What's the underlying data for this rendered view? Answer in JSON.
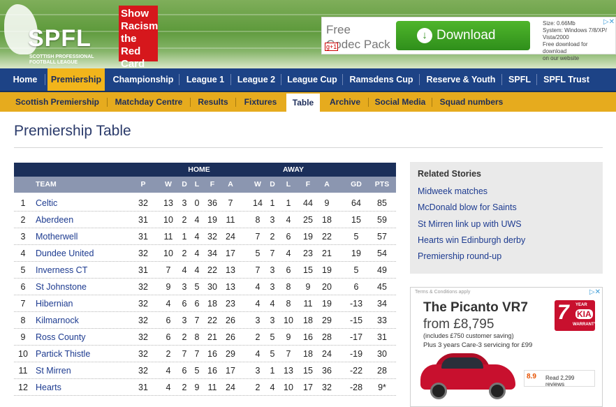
{
  "header": {
    "brand": "SPFL",
    "brand_sub": "SCOTTISH PROFESSIONAL FOOTBALL LEAGUE",
    "badge_lines": [
      "Show",
      "Racism",
      "the Red",
      "Card"
    ],
    "ad": {
      "title_line1": "Free",
      "title_line2": "Codec Pack",
      "button_label": "Download",
      "info_lines": [
        "Size: 0.66Mb",
        "System: Windows 7/8/XP/",
        "Vista/2000",
        "Free download for download",
        "on our website"
      ],
      "close": "▷✕"
    }
  },
  "nav_primary": [
    {
      "label": "Home",
      "active": false
    },
    {
      "label": "Premiership",
      "active": true
    },
    {
      "label": "Championship",
      "active": false
    },
    {
      "label": "League 1",
      "active": false
    },
    {
      "label": "League 2",
      "active": false
    },
    {
      "label": "League Cup",
      "active": false
    },
    {
      "label": "Ramsdens Cup",
      "active": false
    },
    {
      "label": "Reserve & Youth",
      "active": false
    },
    {
      "label": "SPFL",
      "active": false
    },
    {
      "label": "SPFL Trust",
      "active": false
    }
  ],
  "nav_secondary": [
    {
      "label": "Scottish Premiership",
      "active": false
    },
    {
      "label": "Matchday Centre",
      "active": false
    },
    {
      "label": "Results",
      "active": false
    },
    {
      "label": "Fixtures",
      "active": false
    },
    {
      "label": "Table",
      "active": true
    },
    {
      "label": "Archive",
      "active": false
    },
    {
      "label": "Social Media",
      "active": false
    },
    {
      "label": "Squad numbers",
      "active": false
    }
  ],
  "page_title": "Premiership Table",
  "table": {
    "group_home": "HOME",
    "group_away": "AWAY",
    "columns": [
      "TEAM",
      "P",
      "W",
      "D",
      "L",
      "F",
      "A",
      "W",
      "D",
      "L",
      "F",
      "A",
      "GD",
      "PTS"
    ],
    "rows": [
      {
        "pos": "1",
        "team": "Celtic",
        "p": "32",
        "hw": "13",
        "hd": "3",
        "hl": "0",
        "hf": "36",
        "ha": "7",
        "aw": "14",
        "ad": "1",
        "al": "1",
        "af": "44",
        "aa": "9",
        "gd": "64",
        "pts": "85"
      },
      {
        "pos": "2",
        "team": "Aberdeen",
        "p": "31",
        "hw": "10",
        "hd": "2",
        "hl": "4",
        "hf": "19",
        "ha": "11",
        "aw": "8",
        "ad": "3",
        "al": "4",
        "af": "25",
        "aa": "18",
        "gd": "15",
        "pts": "59"
      },
      {
        "pos": "3",
        "team": "Motherwell",
        "p": "31",
        "hw": "11",
        "hd": "1",
        "hl": "4",
        "hf": "32",
        "ha": "24",
        "aw": "7",
        "ad": "2",
        "al": "6",
        "af": "19",
        "aa": "22",
        "gd": "5",
        "pts": "57"
      },
      {
        "pos": "4",
        "team": "Dundee United",
        "p": "32",
        "hw": "10",
        "hd": "2",
        "hl": "4",
        "hf": "34",
        "ha": "17",
        "aw": "5",
        "ad": "7",
        "al": "4",
        "af": "23",
        "aa": "21",
        "gd": "19",
        "pts": "54"
      },
      {
        "pos": "5",
        "team": "Inverness CT",
        "p": "31",
        "hw": "7",
        "hd": "4",
        "hl": "4",
        "hf": "22",
        "ha": "13",
        "aw": "7",
        "ad": "3",
        "al": "6",
        "af": "15",
        "aa": "19",
        "gd": "5",
        "pts": "49"
      },
      {
        "pos": "6",
        "team": "St Johnstone",
        "p": "32",
        "hw": "9",
        "hd": "3",
        "hl": "5",
        "hf": "30",
        "ha": "13",
        "aw": "4",
        "ad": "3",
        "al": "8",
        "af": "9",
        "aa": "20",
        "gd": "6",
        "pts": "45"
      },
      {
        "pos": "7",
        "team": "Hibernian",
        "p": "32",
        "hw": "4",
        "hd": "6",
        "hl": "6",
        "hf": "18",
        "ha": "23",
        "aw": "4",
        "ad": "4",
        "al": "8",
        "af": "11",
        "aa": "19",
        "gd": "-13",
        "pts": "34"
      },
      {
        "pos": "8",
        "team": "Kilmarnock",
        "p": "32",
        "hw": "6",
        "hd": "3",
        "hl": "7",
        "hf": "22",
        "ha": "26",
        "aw": "3",
        "ad": "3",
        "al": "10",
        "af": "18",
        "aa": "29",
        "gd": "-15",
        "pts": "33"
      },
      {
        "pos": "9",
        "team": "Ross County",
        "p": "32",
        "hw": "6",
        "hd": "2",
        "hl": "8",
        "hf": "21",
        "ha": "26",
        "aw": "2",
        "ad": "5",
        "al": "9",
        "af": "16",
        "aa": "28",
        "gd": "-17",
        "pts": "31"
      },
      {
        "pos": "10",
        "team": "Partick Thistle",
        "p": "32",
        "hw": "2",
        "hd": "7",
        "hl": "7",
        "hf": "16",
        "ha": "29",
        "aw": "4",
        "ad": "5",
        "al": "7",
        "af": "18",
        "aa": "24",
        "gd": "-19",
        "pts": "30"
      },
      {
        "pos": "11",
        "team": "St Mirren",
        "p": "32",
        "hw": "4",
        "hd": "6",
        "hl": "5",
        "hf": "16",
        "ha": "17",
        "aw": "3",
        "ad": "1",
        "al": "13",
        "af": "15",
        "aa": "36",
        "gd": "-22",
        "pts": "28"
      },
      {
        "pos": "12",
        "team": "Hearts",
        "p": "31",
        "hw": "4",
        "hd": "2",
        "hl": "9",
        "hf": "11",
        "ha": "24",
        "aw": "2",
        "ad": "4",
        "al": "10",
        "af": "17",
        "aa": "32",
        "gd": "-28",
        "pts": "9*"
      }
    ]
  },
  "related": {
    "heading": "Related Stories",
    "stories": [
      "Midweek matches",
      "McDonald blow for Saints",
      "St Mirren link up with UWS",
      "Hearts win Edinburgh derby",
      "Premiership round-up"
    ]
  },
  "side_ad": {
    "terms": "Terms & Conditions apply",
    "close": "▷✕",
    "model": "The Picanto VR7",
    "price": "from £8,795",
    "note1": "(includes £750 customer saving)",
    "note2": "Plus 3 years Care-3 servicing for £99",
    "kia_seven": "7",
    "kia_year": "YEAR",
    "kia_brand": "KIA",
    "kia_warranty": "WARRANTY",
    "review_score": "8.9",
    "review_text": "Read 2,299 reviews"
  }
}
